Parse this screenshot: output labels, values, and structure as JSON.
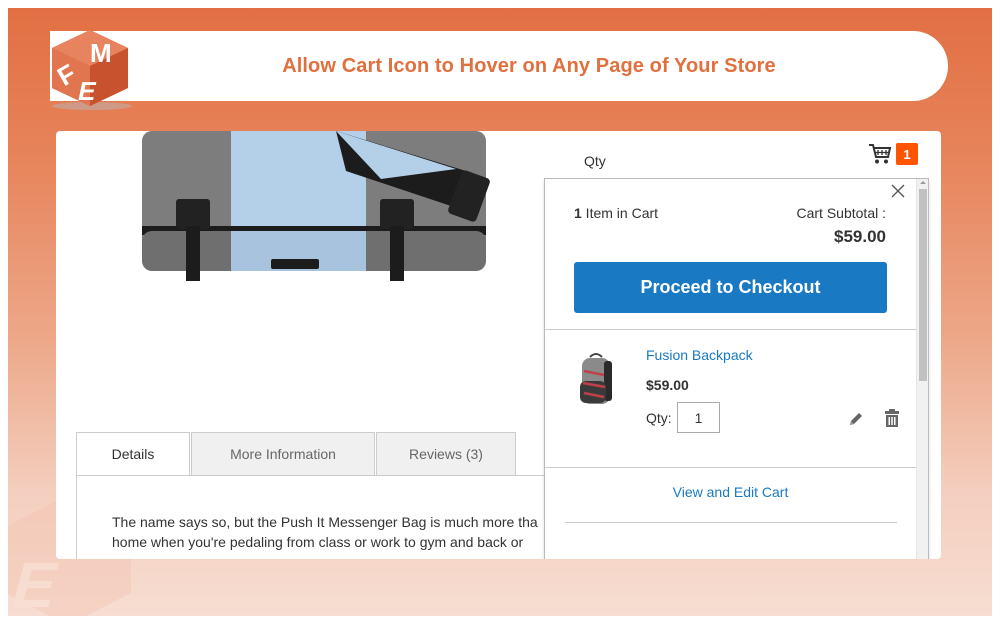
{
  "banner": {
    "title": "Allow Cart Icon to Hover on Any Page of Your Store",
    "logo_letters": [
      "F",
      "M",
      "E"
    ]
  },
  "colors": {
    "brand_orange": "#e2703f",
    "checkout_blue": "#1979c3",
    "cart_badge": "#ff5501"
  },
  "product": {
    "qty_label": "Qty",
    "tabs": [
      {
        "label": "Details",
        "active": true
      },
      {
        "label": "More Information",
        "active": false
      },
      {
        "label": "Reviews (3)",
        "active": false
      }
    ],
    "description_lines": [
      "The name says so, but the Push It Messenger Bag is much more tha",
      "home when you're pedaling from class or work to gym and back or"
    ]
  },
  "header_cart": {
    "icon": "shopping-cart-icon",
    "count": "1"
  },
  "minicart": {
    "close_icon": "close-icon",
    "items_count": "1",
    "items_label": " Item in Cart",
    "subtotal_label": "Cart Subtotal :",
    "subtotal_value": "$59.00",
    "checkout_label": "Proceed to Checkout",
    "items": [
      {
        "name": "Fusion Backpack",
        "price": "$59.00",
        "qty_label": "Qty:",
        "qty": "1",
        "edit_icon": "pencil-icon",
        "delete_icon": "trash-icon"
      }
    ],
    "view_cart_label": "View and Edit Cart"
  }
}
